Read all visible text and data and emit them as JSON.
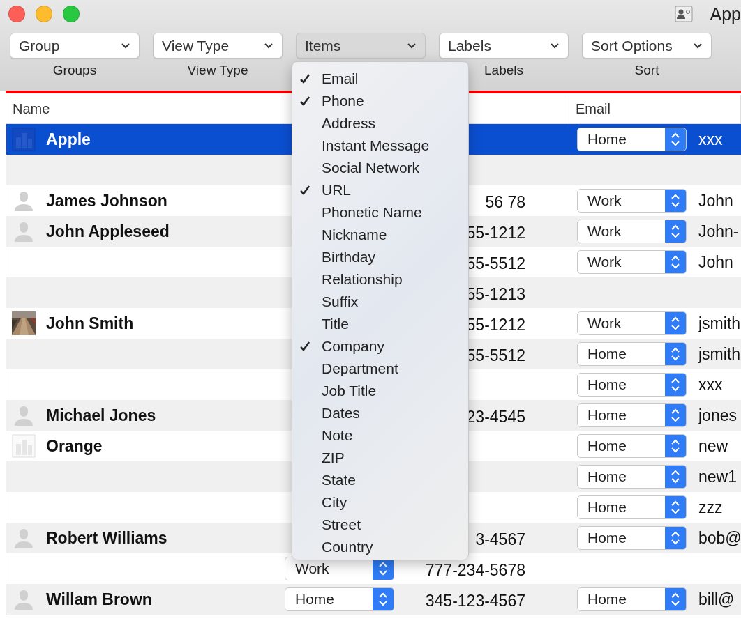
{
  "window": {
    "title": "App"
  },
  "toolbar": [
    {
      "value": "Group",
      "label": "Groups",
      "open": false
    },
    {
      "value": "View Type",
      "label": "View Type",
      "open": false
    },
    {
      "value": "Items",
      "open": true
    },
    {
      "value": "Labels",
      "label": "Labels",
      "open": false
    },
    {
      "value": "Sort Options",
      "label": "Sort",
      "open": false
    }
  ],
  "table": {
    "columns": [
      "Name",
      "Email"
    ],
    "rows": [
      {
        "name": "Apple",
        "avatar": {
          "kind": "company"
        },
        "selected": true,
        "email": {
          "type": "Home",
          "address": "xxx"
        }
      },
      {
        "selected": false
      },
      {
        "name": "James Johnson",
        "avatar": {
          "kind": "person"
        },
        "selected": false,
        "phone": {
          "number": "56 78"
        },
        "email": {
          "type": "Work",
          "address": "John"
        }
      },
      {
        "name": "John Appleseed",
        "avatar": {
          "kind": "person"
        },
        "selected": false,
        "phone": {
          "number": "55-1212"
        },
        "email": {
          "type": "Work",
          "address": "John-"
        }
      },
      {
        "selected": false,
        "phone": {
          "number": "55-5512"
        },
        "email": {
          "type": "Work",
          "address": "John"
        }
      },
      {
        "selected": false,
        "phone": {
          "number": "55-1213"
        }
      },
      {
        "name": "John Smith",
        "selected": false,
        "phone": {
          "number": "55-1212"
        },
        "email": {
          "type": "Work",
          "address": "jsmith"
        }
      },
      {
        "selected": false,
        "phone": {
          "number": "55-5512"
        },
        "email": {
          "type": "Home",
          "address": "jsmith"
        }
      },
      {
        "selected": false,
        "email": {
          "type": "Home",
          "address": "xxx"
        }
      },
      {
        "name": "Michael Jones",
        "avatar": {
          "kind": "person"
        },
        "selected": false,
        "phone": {
          "number": "23-4545"
        },
        "email": {
          "type": "Home",
          "address": "jones"
        }
      },
      {
        "name": "Orange",
        "avatar": {
          "kind": "company"
        },
        "selected": false,
        "email": {
          "type": "Home",
          "address": "new"
        }
      },
      {
        "selected": false,
        "email": {
          "type": "Home",
          "address": "new1"
        }
      },
      {
        "selected": false,
        "email": {
          "type": "Home",
          "address": "zzz"
        }
      },
      {
        "name": "Robert Williams",
        "avatar": {
          "kind": "person"
        },
        "selected": false,
        "phone": {
          "number": "3-4567"
        },
        "email": {
          "type": "Home",
          "address": "bob@"
        }
      },
      {
        "selected": false,
        "phone": {
          "type": "Work",
          "number": "777-234-5678"
        }
      },
      {
        "name": "Willam Brown",
        "avatar": {
          "kind": "person"
        },
        "selected": false,
        "phone": {
          "type": "Home",
          "number": "345-123-4567"
        },
        "email": {
          "type": "Home",
          "address": "bill@"
        }
      }
    ]
  },
  "items_menu": [
    {
      "label": "Email",
      "checked": true
    },
    {
      "label": "Phone",
      "checked": true
    },
    {
      "label": "Address",
      "checked": false
    },
    {
      "label": "Instant Message",
      "checked": false
    },
    {
      "label": "Social Network",
      "checked": false
    },
    {
      "label": "URL",
      "checked": true
    },
    {
      "label": "Phonetic Name",
      "checked": false
    },
    {
      "label": "Nickname",
      "checked": false
    },
    {
      "label": "Birthday",
      "checked": false
    },
    {
      "label": "Relationship",
      "checked": false
    },
    {
      "label": "Suffix",
      "checked": false
    },
    {
      "label": "Title",
      "checked": false
    },
    {
      "label": "Company",
      "checked": true
    },
    {
      "label": "Department",
      "checked": false
    },
    {
      "label": "Job Title",
      "checked": false
    },
    {
      "label": "Dates",
      "checked": false
    },
    {
      "label": "Note",
      "checked": false
    },
    {
      "label": "ZIP",
      "checked": false
    },
    {
      "label": "State",
      "checked": false
    },
    {
      "label": "City",
      "checked": false
    },
    {
      "label": "Street",
      "checked": false
    },
    {
      "label": "Country",
      "checked": false
    }
  ]
}
